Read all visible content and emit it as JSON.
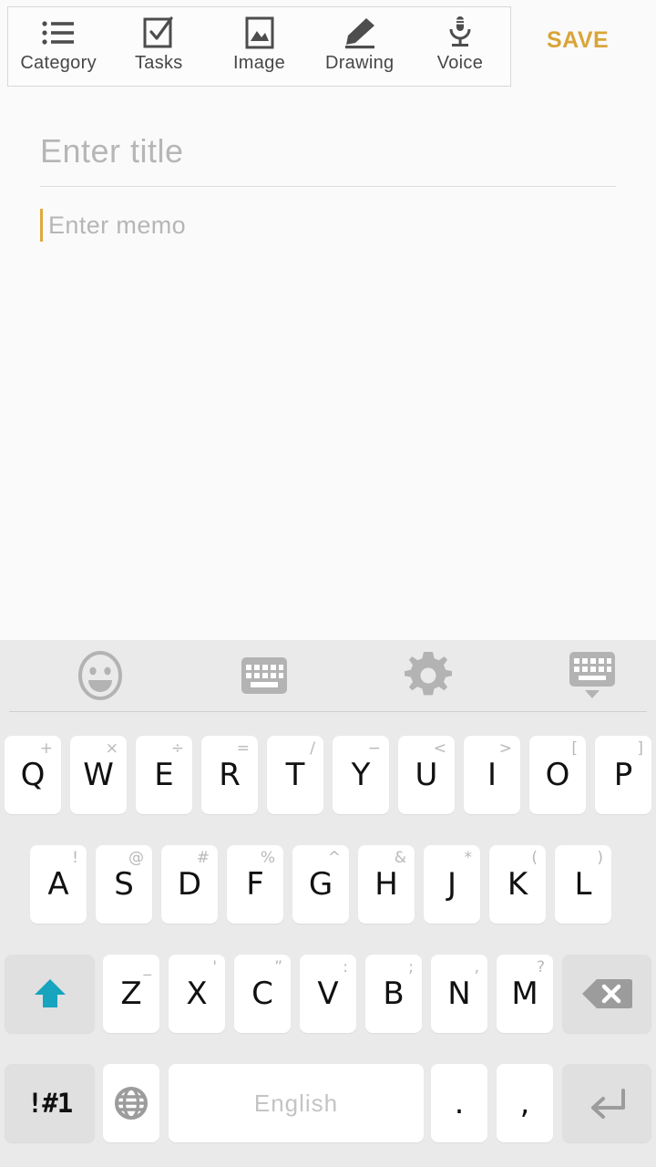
{
  "app": {
    "save_label": "SAVE",
    "accent_save_color": "#d9a53a",
    "caret_color": "#e0a93c"
  },
  "toolbar": {
    "items": [
      {
        "label": "Category",
        "icon": "list-icon"
      },
      {
        "label": "Tasks",
        "icon": "checkbox-check-icon"
      },
      {
        "label": "Image",
        "icon": "image-icon"
      },
      {
        "label": "Drawing",
        "icon": "pencil-icon"
      },
      {
        "label": "Voice",
        "icon": "microphone-icon"
      }
    ]
  },
  "note": {
    "title_value": "",
    "title_placeholder": "Enter title",
    "memo_value": "",
    "memo_placeholder": "Enter memo"
  },
  "keyboard": {
    "toolbar_icons": [
      "emoji-icon",
      "keyboard-icon",
      "gear-icon",
      "hide-keyboard-icon"
    ],
    "shift_color": "#16a4be",
    "rows": [
      [
        {
          "main": "Q",
          "alt": "+"
        },
        {
          "main": "W",
          "alt": "×"
        },
        {
          "main": "E",
          "alt": "÷"
        },
        {
          "main": "R",
          "alt": "="
        },
        {
          "main": "T",
          "alt": "/"
        },
        {
          "main": "Y",
          "alt": "−"
        },
        {
          "main": "U",
          "alt": "<"
        },
        {
          "main": "I",
          "alt": ">"
        },
        {
          "main": "O",
          "alt": "["
        },
        {
          "main": "P",
          "alt": "]"
        }
      ],
      [
        {
          "main": "A",
          "alt": "!"
        },
        {
          "main": "S",
          "alt": "@"
        },
        {
          "main": "D",
          "alt": "#"
        },
        {
          "main": "F",
          "alt": "%"
        },
        {
          "main": "G",
          "alt": "^"
        },
        {
          "main": "H",
          "alt": "&"
        },
        {
          "main": "J",
          "alt": "*"
        },
        {
          "main": "K",
          "alt": "("
        },
        {
          "main": "L",
          "alt": ")"
        }
      ],
      [
        {
          "main": "Z",
          "alt": "_"
        },
        {
          "main": "X",
          "alt": "'"
        },
        {
          "main": "C",
          "alt": "”"
        },
        {
          "main": "V",
          "alt": ":"
        },
        {
          "main": "B",
          "alt": ";"
        },
        {
          "main": "N",
          "alt": ","
        },
        {
          "main": "M",
          "alt": "?"
        }
      ]
    ],
    "shift_key": "shift-icon",
    "backspace_key": "backspace-icon",
    "symbol_key_label": "!#1",
    "language_key": "globe-icon",
    "space_label": "English",
    "period_key": ".",
    "comma_key": ",",
    "enter_key": "enter-icon"
  }
}
